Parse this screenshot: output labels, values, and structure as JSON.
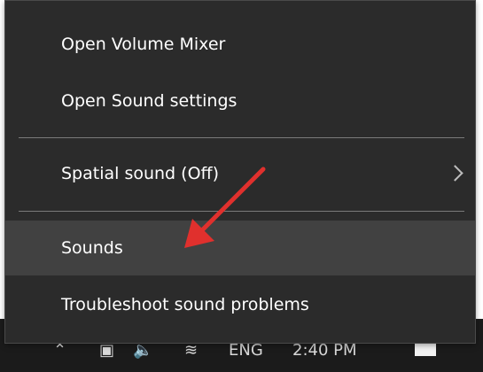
{
  "menu": {
    "items": [
      {
        "label": "Open Volume Mixer"
      },
      {
        "label": "Open Sound settings"
      },
      {
        "label": "Spatial sound (Off)"
      },
      {
        "label": "Sounds"
      },
      {
        "label": "Troubleshoot sound problems"
      }
    ],
    "highlighted_item": "Sounds"
  },
  "taskbar": {
    "language": "ENG",
    "clock": "2:40 PM"
  },
  "colors": {
    "menu_background": "#2b2b2b",
    "menu_text": "#ffffff",
    "highlight": "#414141",
    "separator": "#7a7a7a",
    "annotation_arrow": "#e0302d"
  },
  "icons": [
    "chevron-right-icon",
    "network-icon",
    "volume-icon",
    "battery-icon",
    "wifi-icon",
    "notification-icon"
  ]
}
